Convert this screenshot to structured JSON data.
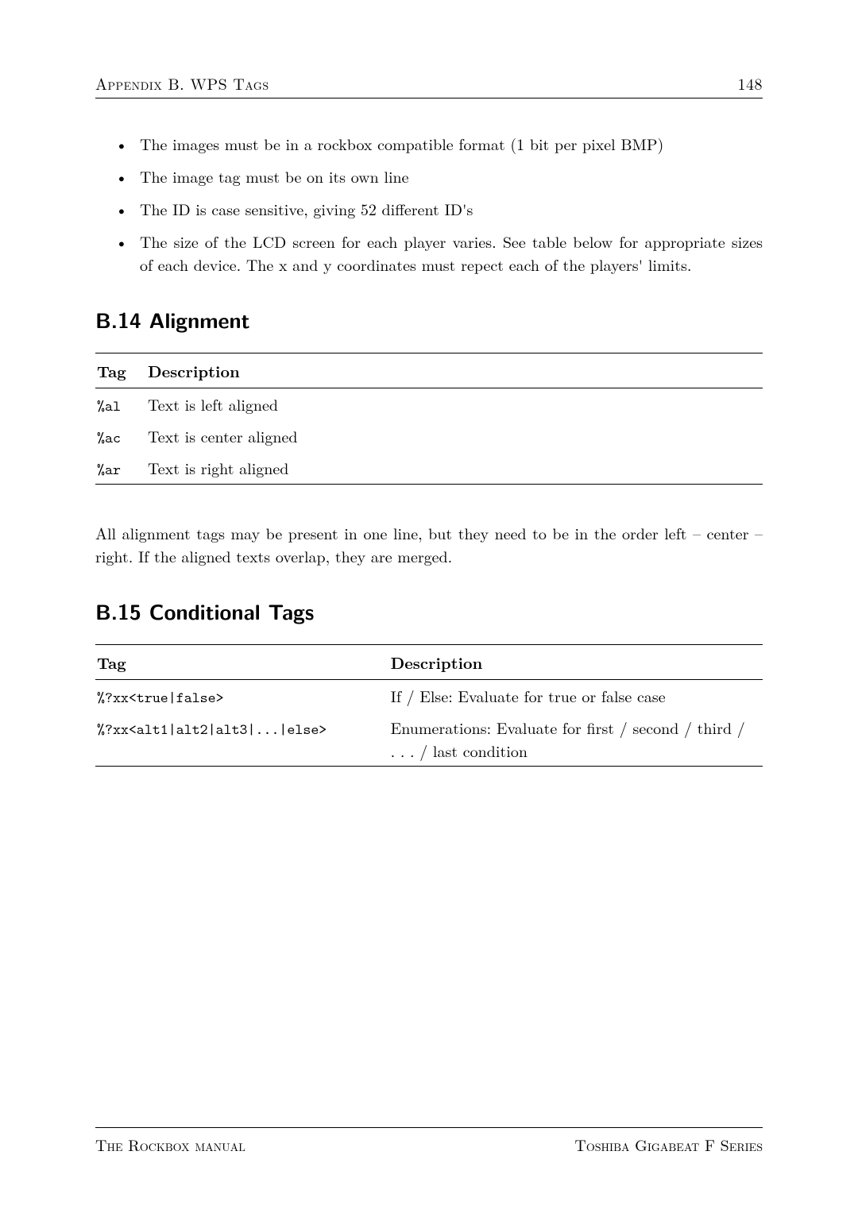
{
  "header": {
    "left": "Appendix B. WPS Tags",
    "right": "148"
  },
  "bullets": [
    "The images must be in a rockbox compatible format (1 bit per pixel BMP)",
    "The image tag must be on its own line",
    "The ID is case sensitive, giving 52 different ID's",
    "The size of the LCD screen for each player varies. See table below for appropriate sizes of each device. The x and y coordinates must repect each of the players' limits."
  ],
  "sections": {
    "alignment": {
      "title": "B.14  Alignment"
    },
    "conditional": {
      "title": "B.15  Conditional Tags"
    }
  },
  "align_table": {
    "head": {
      "tag": "Tag",
      "desc": "Description"
    },
    "rows": [
      {
        "tag": "%al",
        "desc": "Text is left aligned"
      },
      {
        "tag": "%ac",
        "desc": "Text is center aligned"
      },
      {
        "tag": "%ar",
        "desc": "Text is right aligned"
      }
    ]
  },
  "align_para": "All alignment tags may be present in one line, but they need to be in the order left – center – right. If the aligned texts overlap, they are merged.",
  "cond_table": {
    "head": {
      "tag": "Tag",
      "desc": "Description"
    },
    "rows": [
      {
        "tag": "%?xx<true|false>",
        "desc": "If / Else: Evaluate for true or false case"
      },
      {
        "tag": "%?xx<alt1|alt2|alt3|...|else>",
        "desc": "Enumerations: Evaluate for first / second / third / . . . / last condition"
      }
    ]
  },
  "footer": {
    "left": "The Rockbox manual",
    "right": "Toshiba Gigabeat F Series"
  }
}
